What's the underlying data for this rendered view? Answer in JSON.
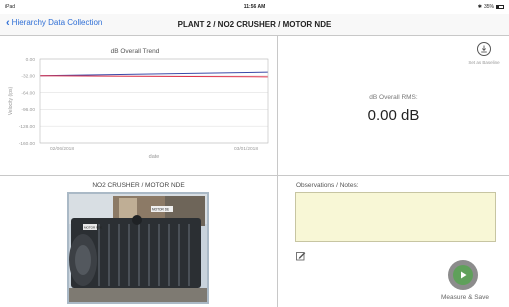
{
  "status_bar": {
    "device": "iPad",
    "time": "11:56 AM",
    "battery": "35%",
    "battery_level": 0.35
  },
  "nav": {
    "back_label": "Hierarchy Data Collection",
    "title": "PLANT 2 / NO2 CRUSHER / MOTOR NDE"
  },
  "chart_data": {
    "type": "line",
    "title": "dB Overall Trend",
    "xlabel": "date",
    "ylabel": "Velocity (ips)",
    "x_ticks": [
      "02/06/2018",
      "03/01/2018"
    ],
    "y_ticks": [
      "0.00",
      "-32.00",
      "-64.00",
      "-96.00",
      "-128.00",
      "-160.00"
    ],
    "ylim": [
      -160,
      0
    ],
    "grid": true,
    "series": [
      {
        "color": "#3b4aa8",
        "x": [
          "02/06/2018",
          "03/01/2018"
        ],
        "values": [
          -32,
          -25
        ]
      },
      {
        "color": "#e0334b",
        "x": [
          "02/06/2018",
          "03/01/2018"
        ],
        "values": [
          -32,
          -34
        ]
      }
    ]
  },
  "rms": {
    "label": "dB Overall RMS:",
    "value": "0.00 dB"
  },
  "baseline": {
    "label": "Set as Baseline"
  },
  "photo": {
    "title": "NO2 CRUSHER / MOTOR NDE",
    "tag": "MOTOR DE",
    "tag2": "MOTOR NDE"
  },
  "observations": {
    "label": "Observations / Notes:",
    "value": ""
  },
  "measure": {
    "label": "Measure & Save"
  },
  "colors": {
    "accent": "#2f6fd6",
    "notes_bg": "#f8f7d6",
    "measure_green": "#5fa05a"
  }
}
